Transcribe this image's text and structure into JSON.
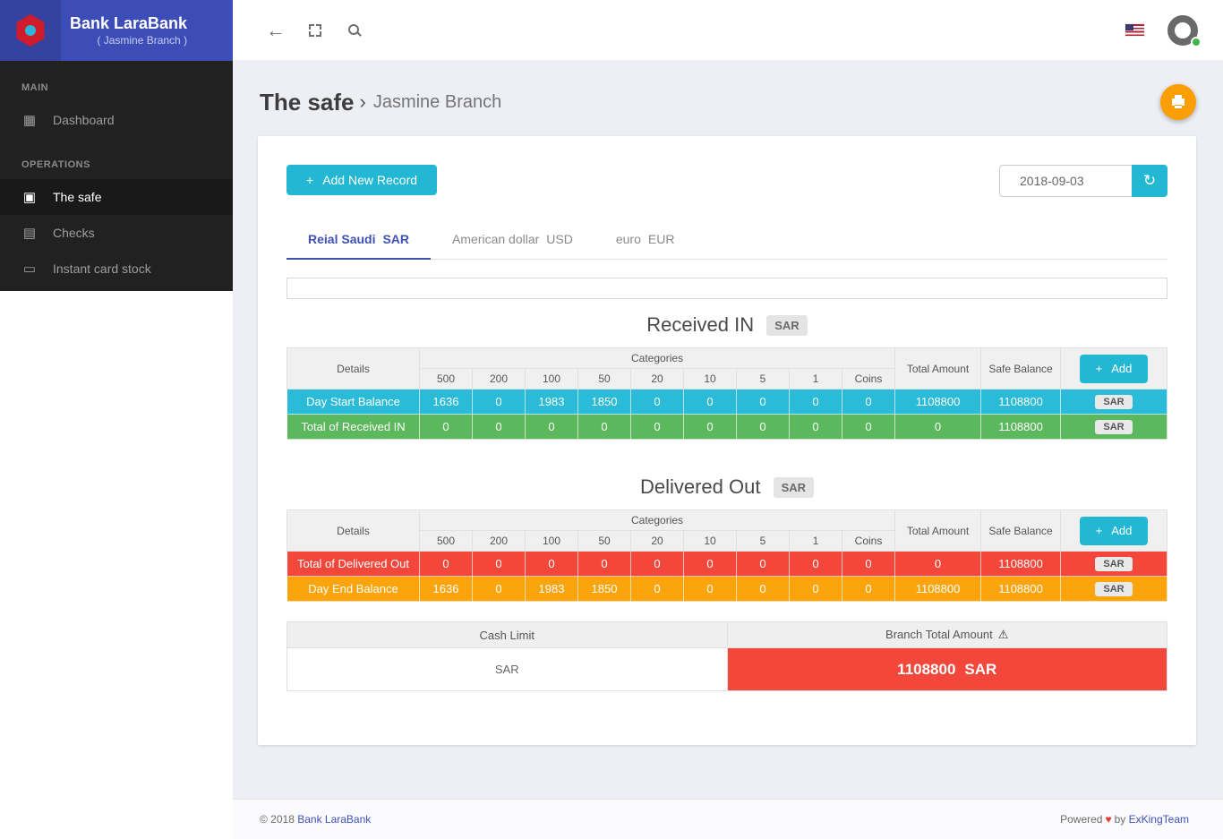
{
  "colors": {
    "header_blue": "#3d4db7",
    "header_blue_dark": "#35429e",
    "sidebar_bg": "#212121",
    "sidebar_active": "#191919",
    "main_bg": "#edeff4",
    "accent_cyan": "#22b8d4",
    "row_cyan": "#2abbd8",
    "row_green": "#5cb85c",
    "row_red": "#f4473b",
    "row_orange": "#fca40b",
    "fab_orange": "#fb9e04",
    "indigo": "#3f51b5",
    "badge_bg": "#e4e4e4"
  },
  "icons": {
    "back": "←",
    "refresh": "↻",
    "plus": "+",
    "dashboard": "▦",
    "safe": "▣",
    "checks": "▤",
    "card": "▭",
    "separator": "›",
    "warning": "⚠",
    "heart": "♥"
  },
  "header": {
    "brand_title": "Bank LaraBank",
    "brand_subtitle": "( Jasmine Branch )"
  },
  "sidebar": {
    "sections": [
      {
        "label": "MAIN",
        "items": [
          {
            "label": "Dashboard",
            "active": false
          }
        ]
      },
      {
        "label": "OPERATIONS",
        "items": [
          {
            "label": "The safe",
            "active": true
          },
          {
            "label": "Checks",
            "active": false
          },
          {
            "label": "Instant card stock",
            "active": false
          }
        ]
      }
    ]
  },
  "page": {
    "title": "The safe",
    "branch": "Jasmine Branch"
  },
  "controls": {
    "add_new_record": "Add New Record",
    "date_value": "2018-09-03"
  },
  "tabs": [
    {
      "label": "Reial Saudi",
      "code": "SAR",
      "active": true
    },
    {
      "label": "American dollar",
      "code": "USD",
      "active": false
    },
    {
      "label": "euro",
      "code": "EUR",
      "active": false
    }
  ],
  "table_columns": {
    "details": "Details",
    "categories_label": "Categories",
    "categories": [
      "500",
      "200",
      "100",
      "50",
      "20",
      "10",
      "5",
      "1",
      "Coins"
    ],
    "total_amount": "Total Amount",
    "safe_balance": "Safe Balance",
    "add_label": "Add"
  },
  "received_in": {
    "heading": "Received IN",
    "currency_badge": "SAR",
    "rows": [
      {
        "label": "Day Start Balance",
        "color": "cyan",
        "values": [
          "1636",
          "0",
          "1983",
          "1850",
          "0",
          "0",
          "0",
          "0",
          "0"
        ],
        "total": "1108800",
        "safe_balance": "1108800",
        "badge": "SAR"
      },
      {
        "label": "Total of Received IN",
        "color": "green",
        "values": [
          "0",
          "0",
          "0",
          "0",
          "0",
          "0",
          "0",
          "0",
          "0"
        ],
        "total": "0",
        "safe_balance": "1108800",
        "badge": "SAR"
      }
    ]
  },
  "delivered_out": {
    "heading": "Delivered Out",
    "currency_badge": "SAR",
    "rows": [
      {
        "label": "Total of Delivered Out",
        "color": "red",
        "values": [
          "0",
          "0",
          "0",
          "0",
          "0",
          "0",
          "0",
          "0",
          "0"
        ],
        "total": "0",
        "safe_balance": "1108800",
        "badge": "SAR"
      },
      {
        "label": "Day End Balance",
        "color": "orange",
        "values": [
          "1636",
          "0",
          "1983",
          "1850",
          "0",
          "0",
          "0",
          "0",
          "0"
        ],
        "total": "1108800",
        "safe_balance": "1108800",
        "badge": "SAR"
      }
    ]
  },
  "summary": {
    "cash_limit_header": "Cash Limit",
    "branch_total_header": "Branch Total Amount",
    "cash_limit_value": "SAR",
    "branch_total_value": "1108800",
    "branch_total_currency": "SAR"
  },
  "footer": {
    "copyright": "© 2018",
    "brand_link": "Bank LaraBank",
    "powered": "Powered",
    "by": "by",
    "team_link": "ExKingTeam"
  }
}
